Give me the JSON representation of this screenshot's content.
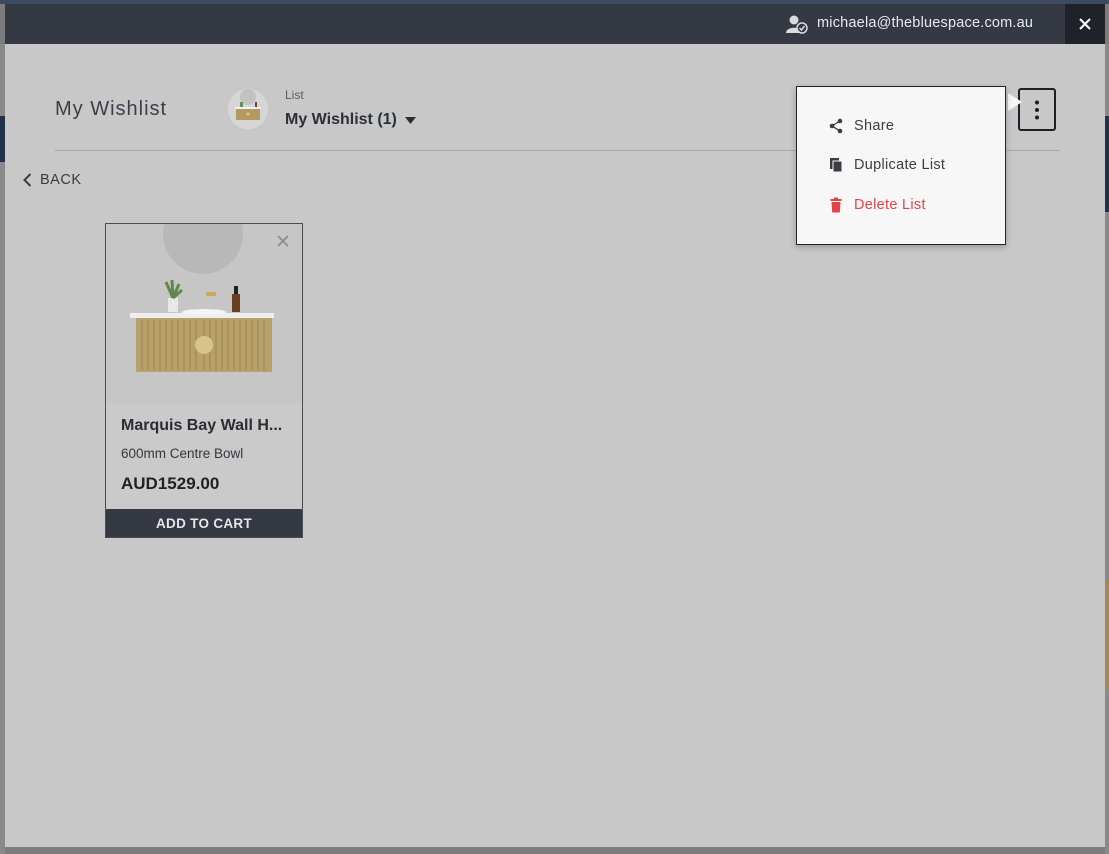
{
  "header": {
    "user_email": "michaela@thebluespace.com.au",
    "user_icon": "user-verified-icon",
    "close_icon": "close-icon"
  },
  "wishlist": {
    "title": "My Wishlist",
    "list_caption": "List",
    "selected_list": "My Wishlist (1)",
    "back_label": "BACK"
  },
  "menu": {
    "items": [
      {
        "label": "Share",
        "icon": "share-icon"
      },
      {
        "label": "Duplicate List",
        "icon": "copy-icon"
      },
      {
        "label": "Delete List",
        "icon": "trash-icon",
        "color": "#e0444a"
      }
    ]
  },
  "products": [
    {
      "name": "Marquis Bay Wall H...",
      "variant": "600mm Centre Bowl",
      "price": "AUD1529.00",
      "cart_label": "ADD TO CART"
    }
  ],
  "colors": {
    "topbar": "#343944",
    "overlay": "#c8c8c8",
    "danger": "#e0444a"
  }
}
